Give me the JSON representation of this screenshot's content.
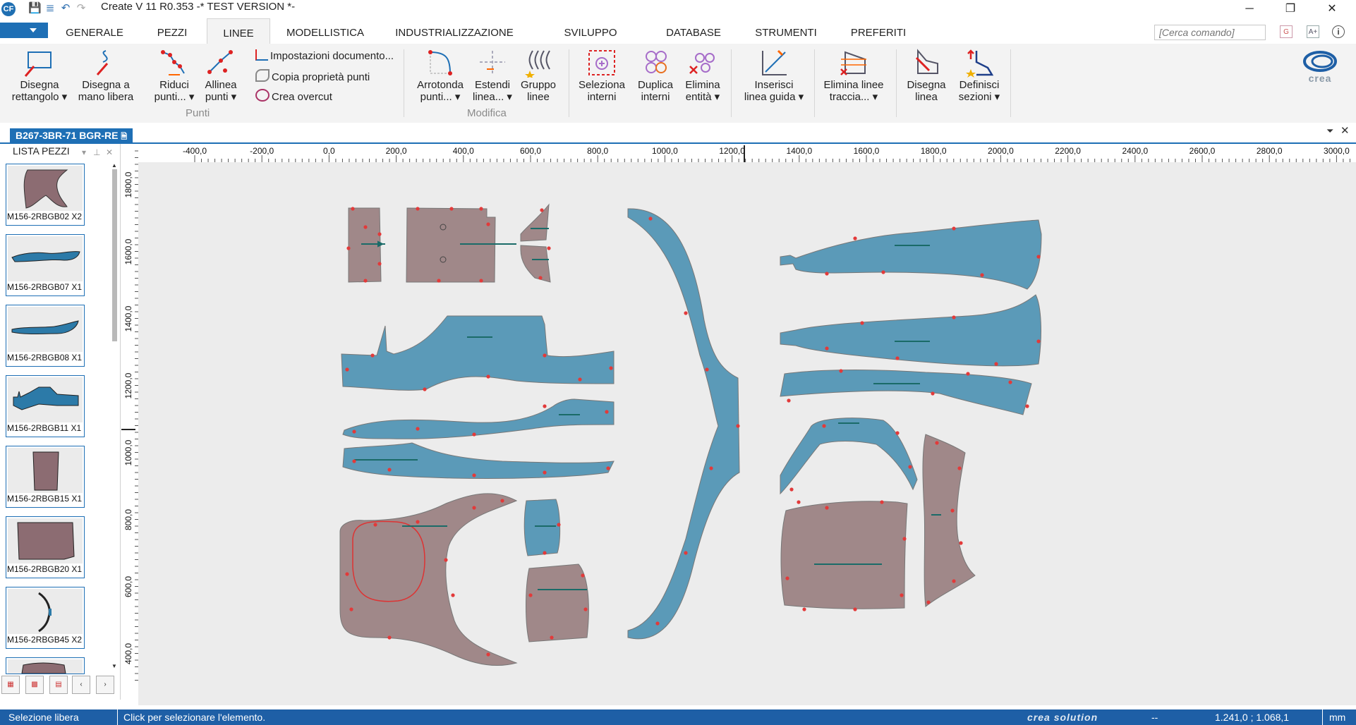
{
  "window": {
    "app_icon": "CF",
    "title": "Create V 11 R0.353 -* TEST VERSION *-",
    "minimize_icon": "─",
    "restore_icon": "❐",
    "close_icon": "✕"
  },
  "menu": {
    "tabs": [
      "GENERALE",
      "PEZZI",
      "LINEE",
      "MODELLISTICA",
      "INDUSTRIALIZZAZIONE",
      "SVILUPPO TAGLIE",
      "DATABASE",
      "STRUMENTI",
      "PREFERITI"
    ],
    "active_tab": "LINEE",
    "search_placeholder": "[Cerca comando]"
  },
  "ribbon": {
    "disegna_rettangolo": [
      "Disegna",
      "rettangolo ▾"
    ],
    "disegna_mano_libera": [
      "Disegna a",
      "mano libera"
    ],
    "riduci_punti": [
      "Riduci",
      "punti... ▾"
    ],
    "allinea_punti": [
      "Allinea",
      "punti ▾"
    ],
    "impostazioni": "Impostazioni documento...",
    "copia_proprieta": "Copia proprietà punti",
    "crea_overcut": "Crea overcut",
    "punti_group": "Punti",
    "arrotonda_punti": [
      "Arrotonda",
      "punti... ▾"
    ],
    "estendi_linea": [
      "Estendi",
      "linea... ▾"
    ],
    "gruppo_linee": [
      "Gruppo",
      "linee"
    ],
    "modifica_group": "Modifica",
    "seleziona_interni": [
      "Seleziona",
      "interni"
    ],
    "duplica_interni": [
      "Duplica",
      "interni"
    ],
    "elimina_entita": [
      "Elimina",
      "entità ▾"
    ],
    "inserisci_linea_guida": [
      "Inserisci",
      "linea guida ▾"
    ],
    "elimina_linee_traccia": [
      "Elimina linee",
      "traccia... ▾"
    ],
    "disegna_linea": [
      "Disegna",
      "linea"
    ],
    "definisci_sezioni": [
      "Definisci",
      "sezioni ▾"
    ],
    "brand": "crea"
  },
  "document": {
    "tab": "B267-3BR-71 BGR-RE"
  },
  "panel": {
    "title": "LISTA PEZZI",
    "items": [
      "M156-2RBGB02 X2",
      "M156-2RBGB07 X1",
      "M156-2RBGB08 X1",
      "M156-2RBGB11 X1",
      "M156-2RBGB15 X1",
      "M156-2RBGB20 X1",
      "M156-2RBGB45 X2"
    ]
  },
  "ruler": {
    "x_ticks": [
      "-400,0",
      "-200,0",
      "0,0",
      "200,0",
      "400,0",
      "600,0",
      "800,0",
      "1000,0",
      "1200,0",
      "1400,0",
      "1600,0",
      "1800,0",
      "2000,0",
      "2200,0",
      "2400,0",
      "2600,0",
      "2800,0",
      "3000,0"
    ],
    "y_ticks": [
      "1800,0",
      "1600,0",
      "1400,0",
      "1200,0",
      "1000,0",
      "800,0",
      "600,0",
      "400,0"
    ]
  },
  "colors": {
    "accent": "#1e6fb5",
    "piece_brown": "#a08889",
    "piece_blue": "#5b9ab8",
    "canvas_bg": "#ececec",
    "statusbar": "#1e5fa6"
  },
  "status": {
    "mode": "Selezione libera",
    "hint": "Click per selezionare l'elemento.",
    "brand": "crea solution",
    "dashes": "--",
    "coords": "1.241,0 ; 1.068,1",
    "unit": "mm"
  }
}
